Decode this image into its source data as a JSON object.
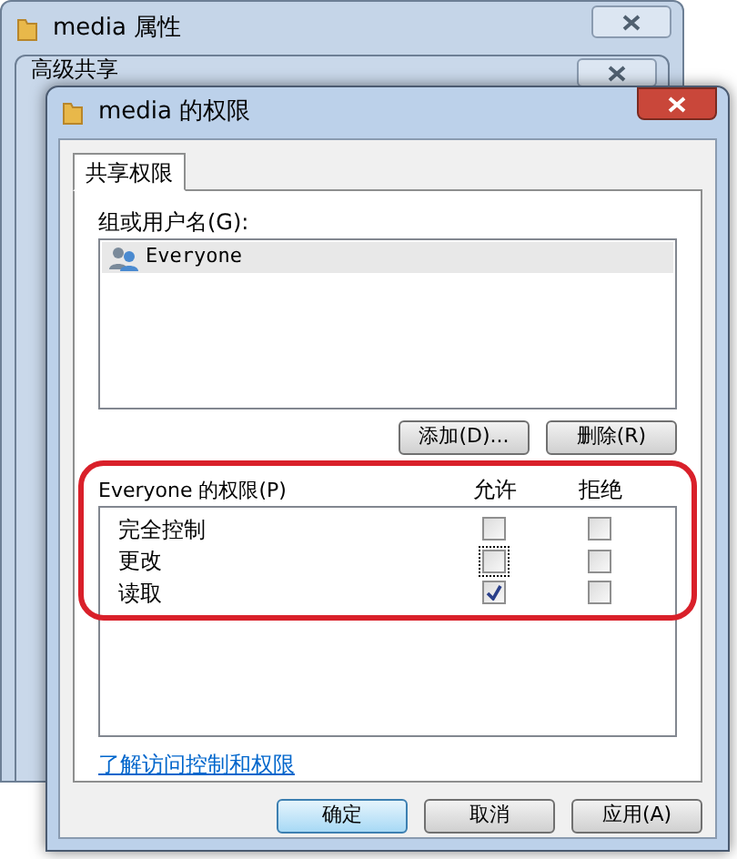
{
  "back_windows": [
    {
      "title": "media 属性"
    },
    {
      "title": "高级共享"
    }
  ],
  "window": {
    "title": "media 的权限"
  },
  "tabs": [
    {
      "label": "共享权限",
      "selected": true
    }
  ],
  "users": {
    "label": "组或用户名(G):",
    "items": [
      {
        "name": "Everyone",
        "selected": true
      }
    ]
  },
  "user_buttons": [
    "添加(D)...",
    "删除(R)"
  ],
  "permissions": {
    "label": "Everyone 的权限(P)",
    "allow_header": "允许",
    "deny_header": "拒绝",
    "rows": [
      {
        "name": "完全控制",
        "allow": false,
        "allow_focused": false,
        "deny": false
      },
      {
        "name": "更改",
        "allow": false,
        "allow_focused": true,
        "deny": false
      },
      {
        "name": "读取",
        "allow": true,
        "allow_focused": false,
        "deny": false
      }
    ]
  },
  "link": "了解访问控制和权限",
  "buttons": [
    {
      "label": "确定",
      "default": true
    },
    {
      "label": "取消",
      "default": false
    },
    {
      "label": "应用(A)",
      "default": false
    }
  ]
}
